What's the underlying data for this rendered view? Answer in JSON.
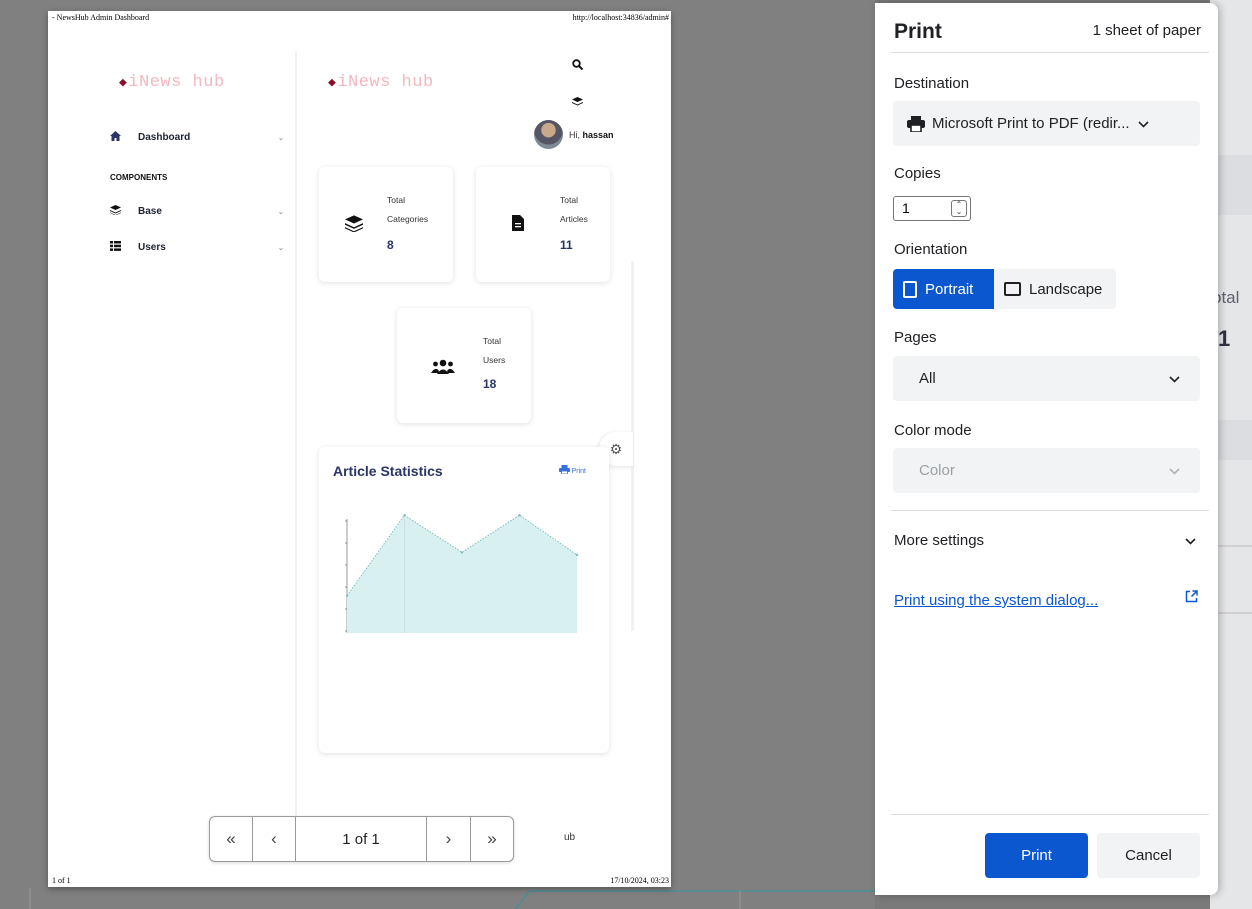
{
  "preview": {
    "header_left": "- NewsHub Admin Dashboard",
    "header_right": "http://localhost:34836/admin#",
    "footer_left": "1 of 1",
    "footer_right": "17/10/2024, 03:23",
    "logo_text": "iNews hub",
    "greeting_prefix": "Hi,",
    "user_name": "hassan",
    "sidebar": {
      "section_label": "COMPONENTS",
      "items": [
        {
          "label": "Dashboard",
          "icon": "home-icon"
        },
        {
          "label": "Base",
          "icon": "layers-icon"
        },
        {
          "label": "Users",
          "icon": "list-icon"
        }
      ]
    },
    "cards": [
      {
        "label1": "Total",
        "label2": "Categories",
        "value": "8",
        "icon": "layers-icon"
      },
      {
        "label1": "Total",
        "label2": "Articles",
        "value": "11",
        "icon": "file-icon"
      },
      {
        "label1": "Total",
        "label2": "Users",
        "value": "18",
        "icon": "users-icon"
      }
    ],
    "chart_card": {
      "title": "Article Statistics",
      "print_label": "Print"
    },
    "behind_text": "ub"
  },
  "chart_data": {
    "type": "area",
    "x": [
      0,
      1,
      2,
      3,
      4
    ],
    "values": [
      0.3,
      0.95,
      0.65,
      0.95,
      0.63
    ],
    "color": "#d8f0f0",
    "line_color": "#7fbdbd"
  },
  "pager": {
    "first": "«",
    "prev": "‹",
    "page_text": "1 of 1",
    "next": "›",
    "last": "»"
  },
  "background": {
    "partial_text": "otal",
    "partial_number": "1"
  },
  "print_panel": {
    "title": "Print",
    "sheets": "1 sheet of paper",
    "destination_label": "Destination",
    "destination_value": "Microsoft Print to PDF (redir...",
    "copies_label": "Copies",
    "copies_value": "1",
    "orientation_label": "Orientation",
    "portrait_label": "Portrait",
    "landscape_label": "Landscape",
    "pages_label": "Pages",
    "pages_value": "All",
    "color_mode_label": "Color mode",
    "color_mode_value": "Color",
    "more_settings": "More settings",
    "system_dialog_link": "Print using the system dialog...",
    "print_button": "Print",
    "cancel_button": "Cancel",
    "accent_color": "#0b57d0"
  }
}
